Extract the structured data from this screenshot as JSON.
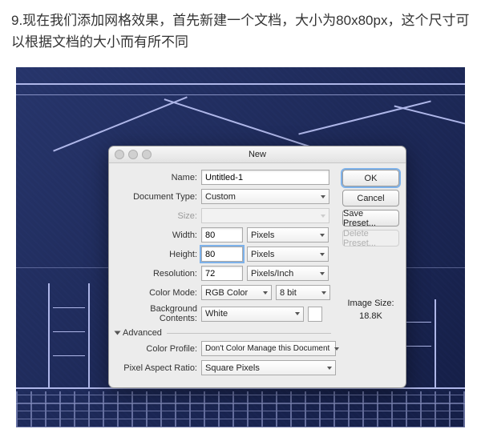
{
  "caption": "9.现在我们添加网格效果，首先新建一个文档，大小为80x80px，这个尺寸可以根据文档的大小而有所不同",
  "dialog": {
    "title": "New",
    "labels": {
      "name": "Name:",
      "doctype": "Document Type:",
      "size": "Size:",
      "width": "Width:",
      "height": "Height:",
      "resolution": "Resolution:",
      "colormode": "Color Mode:",
      "bgcontents": "Background Contents:",
      "advanced": "Advanced",
      "colorprofile": "Color Profile:",
      "pixelratio": "Pixel Aspect Ratio:"
    },
    "values": {
      "name": "Untitled-1",
      "doctype": "Custom",
      "size": "",
      "width": "80",
      "height": "80",
      "resolution": "72",
      "unit_px": "Pixels",
      "unit_ppi": "Pixels/Inch",
      "colormode": "RGB Color",
      "bitdepth": "8 bit",
      "bgcontents": "White",
      "colorprofile": "Don't Color Manage this Document",
      "pixelratio": "Square Pixels"
    },
    "buttons": {
      "ok": "OK",
      "cancel": "Cancel",
      "savepreset": "Save Preset...",
      "deletepreset": "Delete Preset..."
    },
    "imagesize": {
      "label": "Image Size:",
      "value": "18.8K"
    }
  }
}
